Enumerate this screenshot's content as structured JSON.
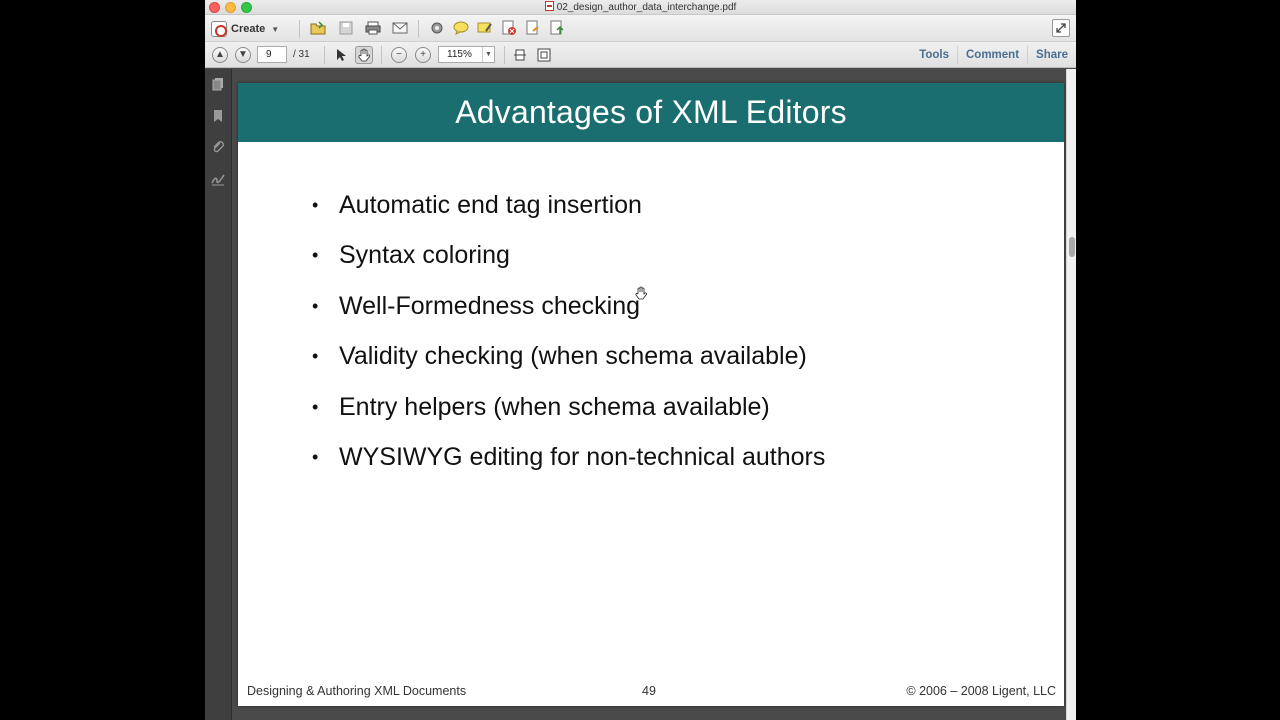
{
  "window": {
    "title": "02_design_author_data_interchange.pdf"
  },
  "toolbar": {
    "create_label": "Create",
    "icons": [
      "open-folder-icon",
      "save-icon",
      "print-icon",
      "email-icon",
      "settings-gear-icon",
      "comment-bubble-icon",
      "highlight-icon",
      "delete-page-icon",
      "export-icon",
      "upload-icon"
    ]
  },
  "navigation": {
    "current_page": "9",
    "total_pages": "/ 31",
    "zoom": "115%"
  },
  "right_panel_links": {
    "tools": "Tools",
    "comment": "Comment",
    "share": "Share"
  },
  "slide": {
    "title": "Advantages of XML Editors",
    "bullets": [
      "Automatic end tag insertion",
      "Syntax coloring",
      "Well-Formedness checking",
      "Validity checking (when schema available)",
      "Entry helpers (when schema available)",
      "WYSIWYG editing for non-technical authors"
    ],
    "bullet_marker": "•",
    "footer_left": "Designing & Authoring XML Documents",
    "footer_page": "49",
    "footer_right": "© 2006 – 2008 Ligent, LLC"
  },
  "colors": {
    "header_bg": "#1a6e70",
    "link": "#4b6e92"
  }
}
